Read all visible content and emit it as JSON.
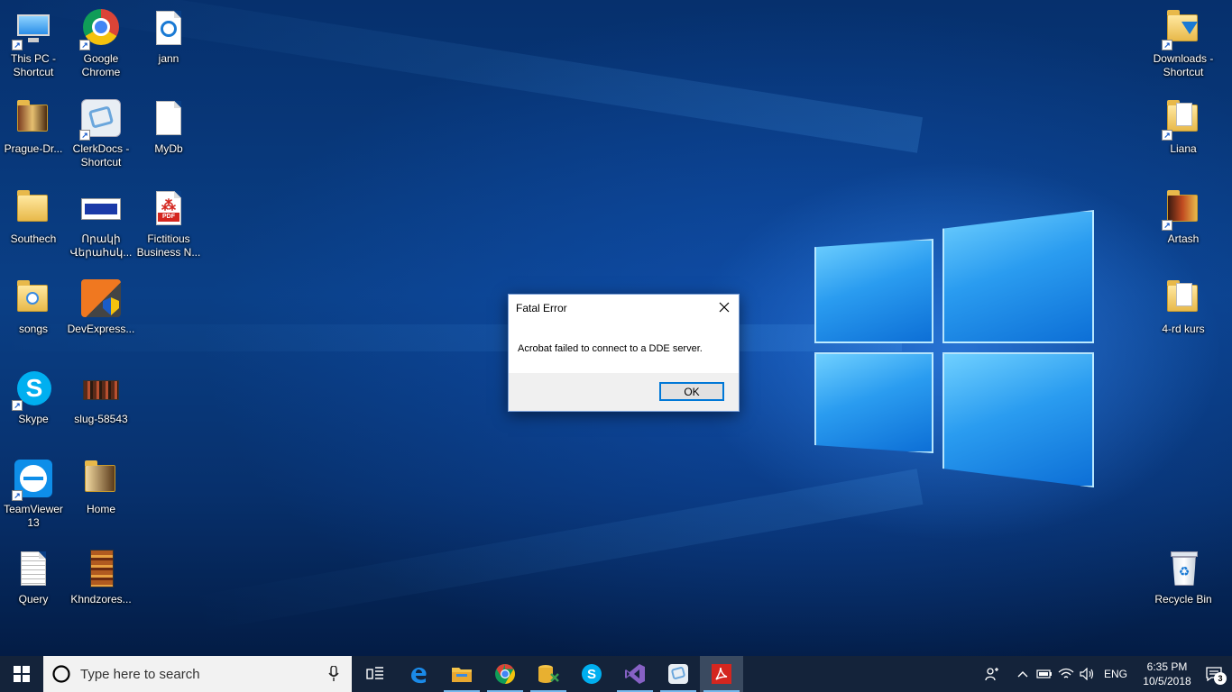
{
  "desktop": {
    "icons": [
      {
        "label": "This PC - Shortcut",
        "icon": "computer-icon"
      },
      {
        "label": "Google Chrome",
        "icon": "chrome-icon"
      },
      {
        "label": "jann",
        "icon": "document-icon"
      },
      {
        "label": "Prague-Dr...",
        "icon": "folder-icon"
      },
      {
        "label": "ClerkDocs - Shortcut",
        "icon": "clerkdocs-icon"
      },
      {
        "label": "MyDb",
        "icon": "file-icon"
      },
      {
        "label": "Southech",
        "icon": "folder-icon"
      },
      {
        "label": "Որակի Վերահսկ...",
        "icon": "image-icon"
      },
      {
        "label": "Fictitious Business N...",
        "icon": "pdf-icon"
      },
      {
        "label": "songs",
        "icon": "folder-icon"
      },
      {
        "label": "DevExpress...",
        "icon": "devexpress-icon"
      },
      {
        "label": "Skype",
        "icon": "skype-icon"
      },
      {
        "label": "slug-58543",
        "icon": "image-icon"
      },
      {
        "label": "TeamViewer 13",
        "icon": "teamviewer-icon"
      },
      {
        "label": "Home",
        "icon": "folder-icon"
      },
      {
        "label": "Query",
        "icon": "text-file-icon"
      },
      {
        "label": "Khndzores...",
        "icon": "image-icon"
      },
      {
        "label": "Downloads - Shortcut",
        "icon": "folder-icon"
      },
      {
        "label": "Liana",
        "icon": "folder-icon"
      },
      {
        "label": "Artash",
        "icon": "folder-icon"
      },
      {
        "label": "4-rd kurs",
        "icon": "folder-icon"
      },
      {
        "label": "Recycle Bin",
        "icon": "recycle-bin-icon"
      }
    ]
  },
  "dialog": {
    "title": "Fatal Error",
    "message": "Acrobat failed to connect to a DDE server.",
    "ok_label": "OK"
  },
  "taskbar": {
    "search_placeholder": "Type here to search",
    "apps": [
      "task-view-icon",
      "edge-icon",
      "file-explorer-icon",
      "chrome-icon",
      "database-tool-icon",
      "skype-icon",
      "visual-studio-icon",
      "clerkdocs-icon",
      "acrobat-icon"
    ]
  },
  "tray": {
    "language": "ENG",
    "time": "6:35 PM",
    "date": "10/5/2018",
    "notification_count": "3"
  },
  "colors": {
    "accent": "#0078d7",
    "taskbar": "#14233a"
  }
}
